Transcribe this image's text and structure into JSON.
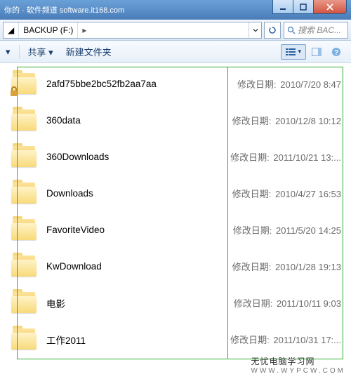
{
  "titlebar": {
    "text": "你的 · 软件频道  software.it168.com"
  },
  "nav": {
    "crumb_prefix": "◢",
    "crumb_drive": "BACKUP (F:)",
    "crumb_sep": "▸",
    "search_placeholder": "搜索 BAC..."
  },
  "toolbar": {
    "share": "共享 ▾",
    "newfolder": "新建文件夹"
  },
  "date_label": "修改日期:",
  "items": [
    {
      "name": "2afd75bbe2bc52fb2aa7aa",
      "date": "2010/7/20 8:47",
      "locked": true
    },
    {
      "name": "360data",
      "date": "2010/12/8 10:12",
      "locked": false
    },
    {
      "name": "360Downloads",
      "date": "2011/10/21 13:...",
      "locked": false
    },
    {
      "name": "Downloads",
      "date": "2010/4/27 16:53",
      "locked": false
    },
    {
      "name": "FavoriteVideo",
      "date": "2011/5/20 14:25",
      "locked": false
    },
    {
      "name": "KwDownload",
      "date": "2010/1/28 19:13",
      "locked": false
    },
    {
      "name": "电影",
      "date": "2011/10/11 9:03",
      "locked": false
    },
    {
      "name": "工作2011",
      "date": "2011/10/31 17:...",
      "locked": false
    }
  ],
  "watermark": {
    "main": "无忧电脑学习网",
    "sub": "WWW.WYPCW.COM"
  }
}
